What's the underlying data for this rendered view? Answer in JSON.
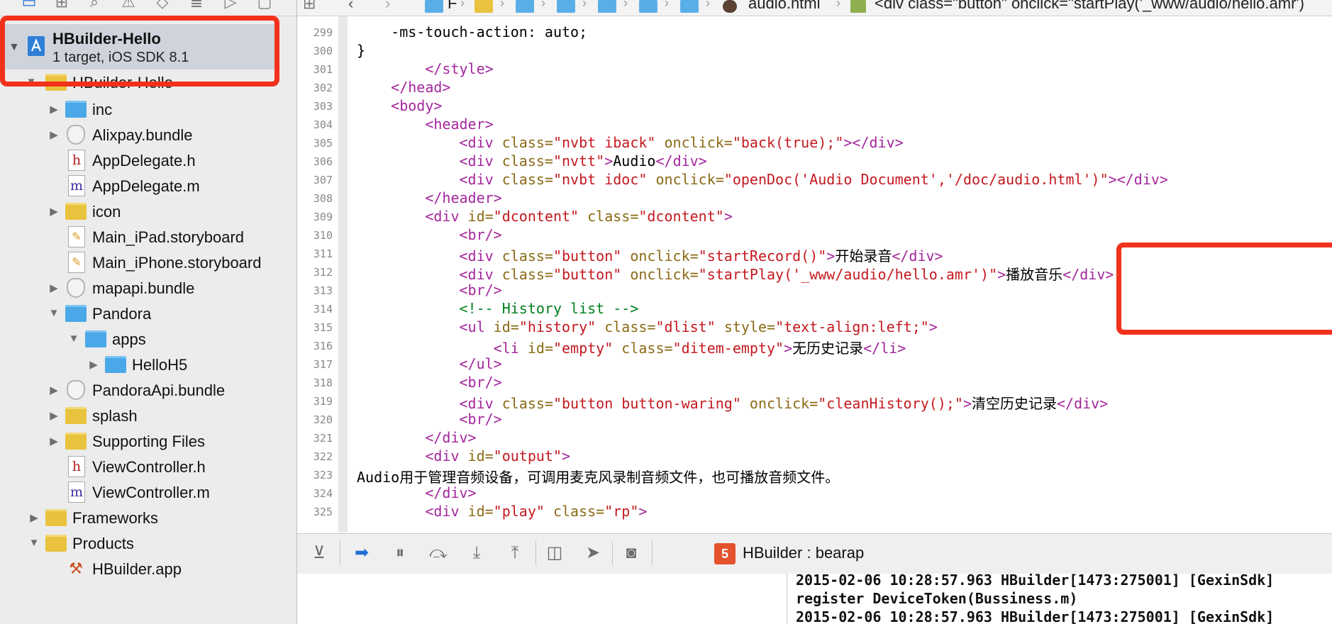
{
  "breadcrumb": {
    "root": "F",
    "file": "audio.html",
    "element": "<div class=\"button\" onclick=\"startPlay('_www/audio/hello.amr')"
  },
  "project": {
    "name": "HBuilder-Hello",
    "subtitle": "1 target, iOS SDK 8.1",
    "partial_group": "HBuilder-Hello"
  },
  "tree": [
    {
      "label": "inc",
      "icon": "folder-blue-icon"
    },
    {
      "label": "Alixpay.bundle",
      "icon": "bundle-icon"
    },
    {
      "label": "AppDelegate.h",
      "icon": "header-file-icon"
    },
    {
      "label": "AppDelegate.m",
      "icon": "source-file-icon"
    },
    {
      "label": "icon",
      "icon": "folder-yellow-icon"
    },
    {
      "label": "Main_iPad.storyboard",
      "icon": "storyboard-icon"
    },
    {
      "label": "Main_iPhone.storyboard",
      "icon": "storyboard-icon"
    },
    {
      "label": "mapapi.bundle",
      "icon": "bundle-icon"
    },
    {
      "label": "Pandora",
      "icon": "folder-blue-icon"
    },
    {
      "label": "apps",
      "icon": "folder-blue-icon"
    },
    {
      "label": "HelloH5",
      "icon": "folder-blue-icon"
    },
    {
      "label": "PandoraApi.bundle",
      "icon": "bundle-icon"
    },
    {
      "label": "splash",
      "icon": "folder-yellow-icon"
    },
    {
      "label": "Supporting Files",
      "icon": "folder-yellow-icon"
    },
    {
      "label": "ViewController.h",
      "icon": "header-file-icon"
    },
    {
      "label": "ViewController.m",
      "icon": "source-file-icon"
    },
    {
      "label": "Frameworks",
      "icon": "folder-yellow-icon"
    },
    {
      "label": "Products",
      "icon": "folder-yellow-icon"
    },
    {
      "label": "HBuilder.app",
      "icon": "app-icon"
    }
  ],
  "line_numbers": [
    "299",
    "300",
    "301",
    "302",
    "303",
    "304",
    "305",
    "306",
    "307",
    "308",
    "309",
    "310",
    "311",
    "312",
    "313",
    "314",
    "315",
    "316",
    "317",
    "318",
    "319",
    "320",
    "321",
    "322",
    "323",
    "324",
    "325"
  ],
  "code": {
    "l299": "    -ms-touch-action: auto;",
    "l300": "}",
    "l311_text": "开始录音",
    "l312_text": "播放音乐",
    "l314_comment": "<!-- History list -->",
    "l316_text": "无历史记录",
    "l319_text": "清空历史记录",
    "l323": "Audio用于管理音频设备，可调用麦克风录制音频文件，也可播放音频文件。"
  },
  "debug": {
    "target": "HBuilder : bearap"
  },
  "console": [
    "2015-02-06 10:28:57.963 HBuilder[1473:275001] [GexinSdk]",
    "register DeviceToken(Bussiness.m)",
    "2015-02-06 10:28:57.963 HBuilder[1473:275001] [GexinSdk]"
  ],
  "colors": {
    "highlight": "#f2311c",
    "tag": "#a3269c",
    "attr": "#8b6a16",
    "string": "#c4191f",
    "comment": "#00801d"
  }
}
